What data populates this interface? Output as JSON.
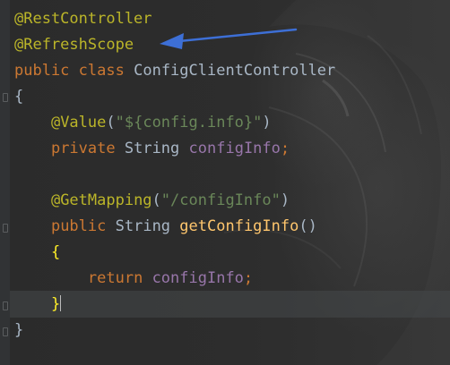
{
  "code": {
    "line1": {
      "annotation": "@RestController"
    },
    "line2": {
      "annotation": "@RefreshScope"
    },
    "line3": {
      "kw1": "public",
      "kw2": "class",
      "class_name": "ConfigClientController"
    },
    "line4": {
      "brace": "{"
    },
    "line5": {
      "annotation": "@Value",
      "open": "(",
      "string": "\"${config.info}\"",
      "close": ")"
    },
    "line6": {
      "kw": "private",
      "type": "String",
      "field": "configInfo",
      "semi": ";"
    },
    "line8": {
      "annotation": "@GetMapping",
      "open": "(",
      "string": "\"/configInfo\"",
      "close": ")"
    },
    "line9": {
      "kw": "public",
      "type": "String",
      "method": "getConfigInfo",
      "parens": "()"
    },
    "line10": {
      "brace": "{"
    },
    "line11": {
      "kw": "return",
      "field": "configInfo",
      "semi": ";"
    },
    "line12": {
      "brace": "}"
    },
    "line13": {
      "brace": "}"
    }
  },
  "colors": {
    "background": "#2b2b2b",
    "annotation": "#bbb529",
    "keyword": "#cc7832",
    "string": "#6a8759",
    "field": "#9876aa",
    "method": "#ffc66d",
    "text": "#a9b7c6",
    "arrow": "#3d6fd6"
  },
  "annotation_arrow": {
    "icon": "arrow-left-icon",
    "points_to": "@RefreshScope"
  }
}
